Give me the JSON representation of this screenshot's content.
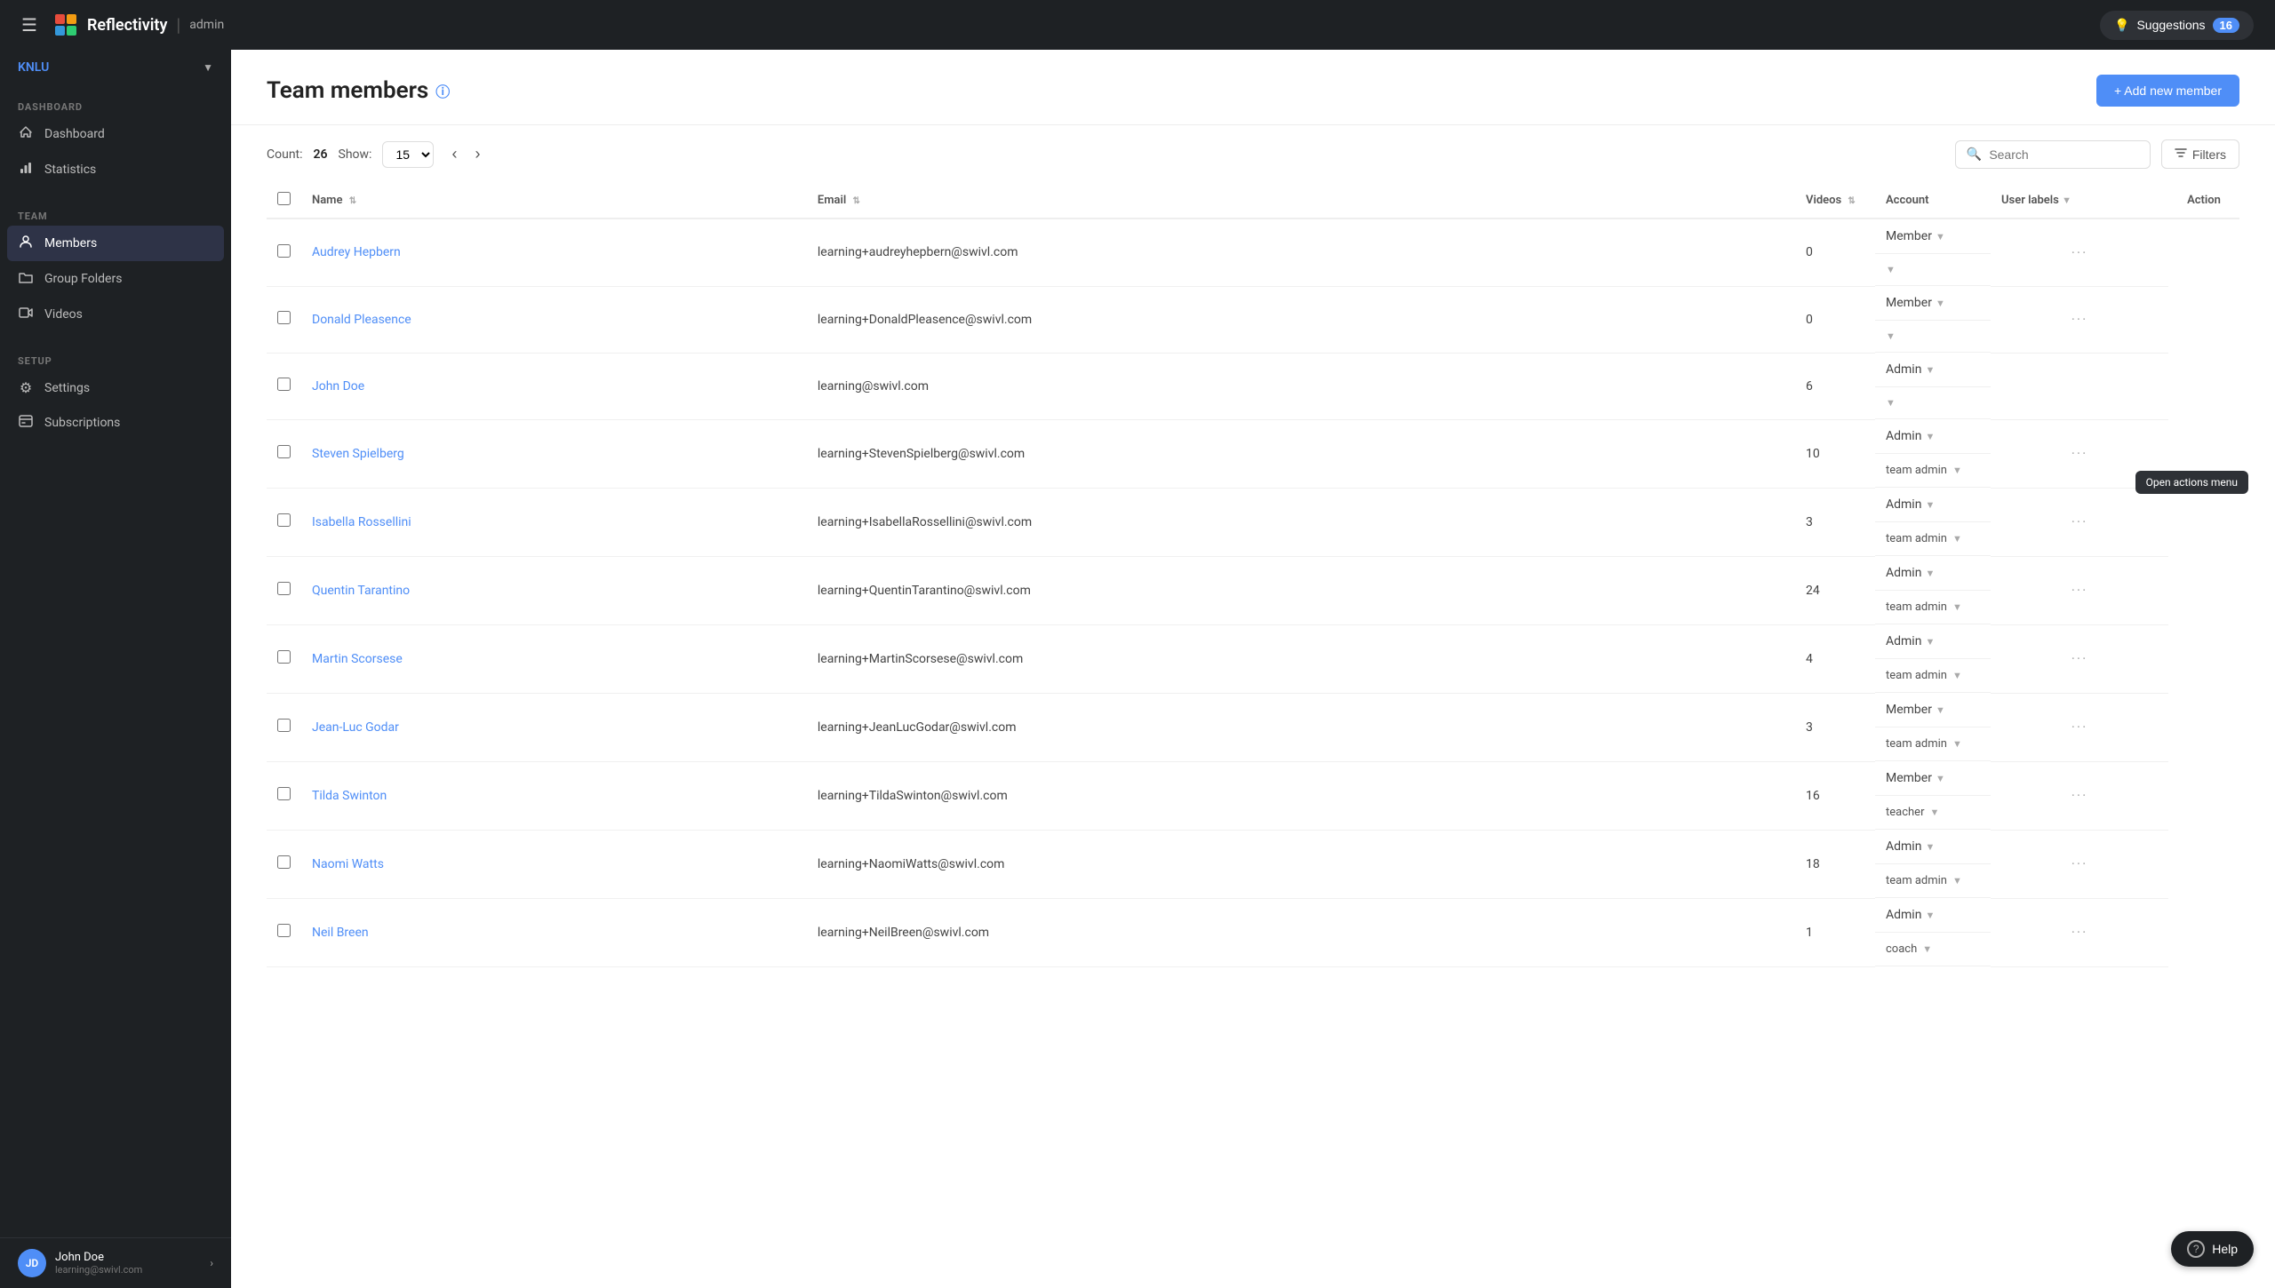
{
  "topbar": {
    "app_name": "Reflectivity",
    "role": "admin",
    "suggestions_label": "Suggestions",
    "suggestions_count": "16"
  },
  "sidebar": {
    "org_name": "KNLU",
    "sections": [
      {
        "label": "DASHBOARD",
        "items": [
          {
            "id": "dashboard",
            "label": "Dashboard",
            "icon": "⟋"
          },
          {
            "id": "statistics",
            "label": "Statistics",
            "icon": "📊"
          }
        ]
      },
      {
        "label": "TEAM",
        "items": [
          {
            "id": "members",
            "label": "Members",
            "icon": "👤",
            "active": true
          },
          {
            "id": "group-folders",
            "label": "Group Folders",
            "icon": "📁"
          },
          {
            "id": "videos",
            "label": "Videos",
            "icon": "🎞"
          }
        ]
      },
      {
        "label": "SETUP",
        "items": [
          {
            "id": "settings",
            "label": "Settings",
            "icon": "⚙"
          },
          {
            "id": "subscriptions",
            "label": "Subscriptions",
            "icon": "📋"
          }
        ]
      }
    ],
    "user": {
      "name": "John Doe",
      "email": "learning@swivl.com",
      "initials": "JD"
    }
  },
  "page": {
    "title": "Team members",
    "add_button": "+ Add new member",
    "count_label": "Count:",
    "count_value": "26",
    "show_label": "Show:",
    "show_value": "15",
    "search_placeholder": "Search",
    "filters_label": "Filters"
  },
  "table": {
    "columns": [
      "",
      "Name",
      "Email",
      "Videos",
      "Account",
      "User labels",
      "Action"
    ],
    "rows": [
      {
        "name": "Audrey Hepbern",
        "email": "learning+audreyhepbern@swivl.com",
        "videos": "0",
        "account": "Member",
        "labels": ""
      },
      {
        "name": "Donald Pleasence",
        "email": "learning+DonaldPleasence@swivl.com",
        "videos": "0",
        "account": "Member",
        "labels": ""
      },
      {
        "name": "John Doe",
        "email": "learning@swivl.com",
        "videos": "6",
        "account": "Admin",
        "labels": ""
      },
      {
        "name": "Steven Spielberg",
        "email": "learning+StevenSpielberg@swivl.com",
        "videos": "10",
        "account": "Admin",
        "labels": "team admin"
      },
      {
        "name": "Isabella Rossellini",
        "email": "learning+IsabellaRossellini@swivl.com",
        "videos": "3",
        "account": "Admin",
        "labels": "team admin"
      },
      {
        "name": "Quentin Tarantino",
        "email": "learning+QuentinTarantino@swivl.com",
        "videos": "24",
        "account": "Admin",
        "labels": "team admin"
      },
      {
        "name": "Martin Scorsese",
        "email": "learning+MartinScorsese@swivl.com",
        "videos": "4",
        "account": "Admin",
        "labels": "team admin"
      },
      {
        "name": "Jean-Luc Godar",
        "email": "learning+JeanLucGodar@swivl.com",
        "videos": "3",
        "account": "Member",
        "labels": "team admin"
      },
      {
        "name": "Tilda Swinton",
        "email": "learning+TildaSwinton@swivl.com",
        "videos": "16",
        "account": "Member",
        "labels": "teacher"
      },
      {
        "name": "Naomi Watts",
        "email": "learning+NaomiWatts@swivl.com",
        "videos": "18",
        "account": "Admin",
        "labels": "team admin"
      },
      {
        "name": "Neil Breen",
        "email": "learning+NeilBreen@swivl.com",
        "videos": "1",
        "account": "Admin",
        "labels": "coach"
      }
    ]
  },
  "tooltip": {
    "text": "Open actions menu"
  },
  "help": {
    "label": "Help"
  }
}
